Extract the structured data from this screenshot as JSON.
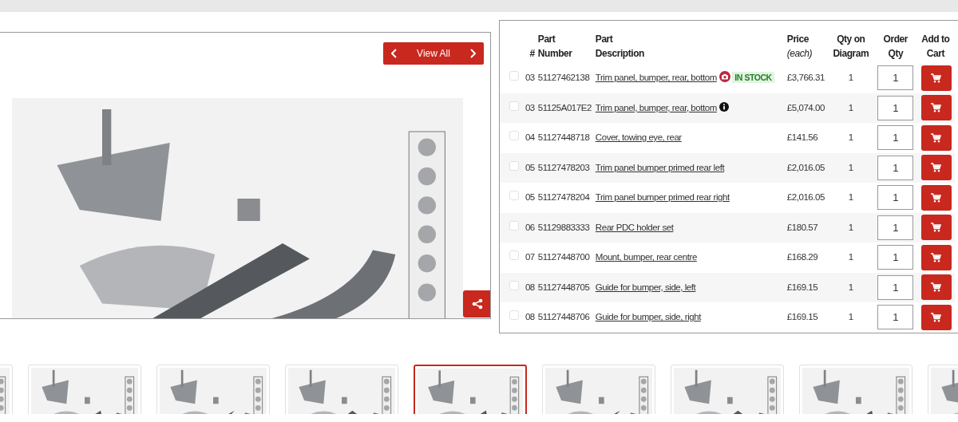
{
  "diagram": {
    "view_all": "View All"
  },
  "table": {
    "columns": [
      {
        "title": "#"
      },
      {
        "title": "Part Number"
      },
      {
        "title": "Part Description"
      },
      {
        "title": "Price",
        "note": "(each)"
      },
      {
        "title": "Qty on Diagram"
      },
      {
        "title": "Order Qty"
      },
      {
        "title": "Add to Cart"
      }
    ],
    "rows": [
      {
        "checked": false,
        "num": "03",
        "part_number": "51127462138",
        "description": "Trim panel, bumper, rear, bottom",
        "stock": "IN STOCK",
        "price": "£3,766.31",
        "qty": "1",
        "order_qty": "1"
      },
      {
        "checked": false,
        "num": "03",
        "part_number": "51125A017E2",
        "description": "Trim panel, bumper, rear, bottom",
        "kind": "info",
        "price": "£5,074.00",
        "qty": "1",
        "order_qty": "1"
      },
      {
        "checked": false,
        "num": "04",
        "part_number": "51127448718",
        "description": "Cover, towing eye, rear",
        "price": "£141.56",
        "qty": "1",
        "order_qty": "1"
      },
      {
        "checked": false,
        "num": "05",
        "part_number": "51127478203",
        "description": "Trim panel bumper primed rear left",
        "price": "£2,016.05",
        "qty": "1",
        "order_qty": "1"
      },
      {
        "checked": false,
        "num": "05",
        "part_number": "51127478204",
        "description": "Trim panel bumper primed rear right",
        "price": "£2,016.05",
        "qty": "1",
        "order_qty": "1"
      },
      {
        "checked": false,
        "num": "06",
        "part_number": "51129883333",
        "description": "Rear PDC holder set",
        "price": "£180.57",
        "qty": "1",
        "order_qty": "1"
      },
      {
        "checked": false,
        "num": "07",
        "part_number": "51127448700",
        "description": "Mount, bumper, rear centre",
        "price": "£168.29",
        "qty": "1",
        "order_qty": "1"
      },
      {
        "checked": false,
        "num": "08",
        "part_number": "51127448705",
        "description": "Guide for bumper, side, left",
        "price": "£169.15",
        "qty": "1",
        "order_qty": "1"
      },
      {
        "checked": false,
        "num": "08",
        "part_number": "51127448706",
        "description": "Guide for bumper, side, right",
        "price": "£169.15",
        "qty": "1",
        "order_qty": "1"
      }
    ]
  },
  "thumbnails": [
    {
      "selected": false
    },
    {
      "selected": false
    },
    {
      "selected": false
    },
    {
      "selected": false
    },
    {
      "selected": true
    },
    {
      "selected": false
    },
    {
      "selected": false
    },
    {
      "selected": false
    },
    {
      "selected": false
    }
  ]
}
